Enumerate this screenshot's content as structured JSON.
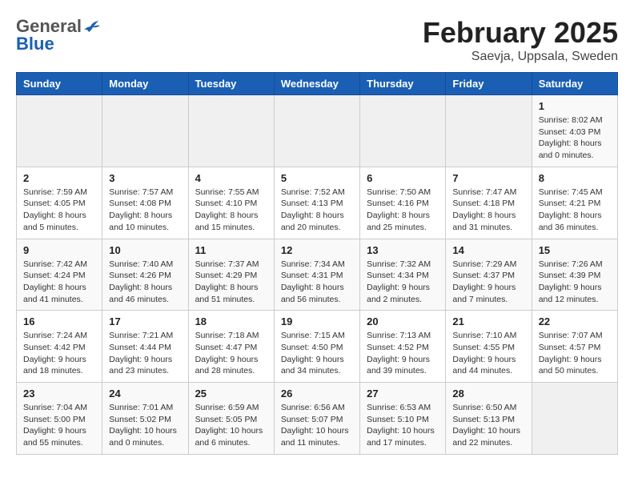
{
  "header": {
    "logo_general": "General",
    "logo_blue": "Blue",
    "month_title": "February 2025",
    "location": "Saevja, Uppsala, Sweden"
  },
  "weekdays": [
    "Sunday",
    "Monday",
    "Tuesday",
    "Wednesday",
    "Thursday",
    "Friday",
    "Saturday"
  ],
  "weeks": [
    [
      {
        "day": "",
        "info": ""
      },
      {
        "day": "",
        "info": ""
      },
      {
        "day": "",
        "info": ""
      },
      {
        "day": "",
        "info": ""
      },
      {
        "day": "",
        "info": ""
      },
      {
        "day": "",
        "info": ""
      },
      {
        "day": "1",
        "info": "Sunrise: 8:02 AM\nSunset: 4:03 PM\nDaylight: 8 hours and 0 minutes."
      }
    ],
    [
      {
        "day": "2",
        "info": "Sunrise: 7:59 AM\nSunset: 4:05 PM\nDaylight: 8 hours and 5 minutes."
      },
      {
        "day": "3",
        "info": "Sunrise: 7:57 AM\nSunset: 4:08 PM\nDaylight: 8 hours and 10 minutes."
      },
      {
        "day": "4",
        "info": "Sunrise: 7:55 AM\nSunset: 4:10 PM\nDaylight: 8 hours and 15 minutes."
      },
      {
        "day": "5",
        "info": "Sunrise: 7:52 AM\nSunset: 4:13 PM\nDaylight: 8 hours and 20 minutes."
      },
      {
        "day": "6",
        "info": "Sunrise: 7:50 AM\nSunset: 4:16 PM\nDaylight: 8 hours and 25 minutes."
      },
      {
        "day": "7",
        "info": "Sunrise: 7:47 AM\nSunset: 4:18 PM\nDaylight: 8 hours and 31 minutes."
      },
      {
        "day": "8",
        "info": "Sunrise: 7:45 AM\nSunset: 4:21 PM\nDaylight: 8 hours and 36 minutes."
      }
    ],
    [
      {
        "day": "9",
        "info": "Sunrise: 7:42 AM\nSunset: 4:24 PM\nDaylight: 8 hours and 41 minutes."
      },
      {
        "day": "10",
        "info": "Sunrise: 7:40 AM\nSunset: 4:26 PM\nDaylight: 8 hours and 46 minutes."
      },
      {
        "day": "11",
        "info": "Sunrise: 7:37 AM\nSunset: 4:29 PM\nDaylight: 8 hours and 51 minutes."
      },
      {
        "day": "12",
        "info": "Sunrise: 7:34 AM\nSunset: 4:31 PM\nDaylight: 8 hours and 56 minutes."
      },
      {
        "day": "13",
        "info": "Sunrise: 7:32 AM\nSunset: 4:34 PM\nDaylight: 9 hours and 2 minutes."
      },
      {
        "day": "14",
        "info": "Sunrise: 7:29 AM\nSunset: 4:37 PM\nDaylight: 9 hours and 7 minutes."
      },
      {
        "day": "15",
        "info": "Sunrise: 7:26 AM\nSunset: 4:39 PM\nDaylight: 9 hours and 12 minutes."
      }
    ],
    [
      {
        "day": "16",
        "info": "Sunrise: 7:24 AM\nSunset: 4:42 PM\nDaylight: 9 hours and 18 minutes."
      },
      {
        "day": "17",
        "info": "Sunrise: 7:21 AM\nSunset: 4:44 PM\nDaylight: 9 hours and 23 minutes."
      },
      {
        "day": "18",
        "info": "Sunrise: 7:18 AM\nSunset: 4:47 PM\nDaylight: 9 hours and 28 minutes."
      },
      {
        "day": "19",
        "info": "Sunrise: 7:15 AM\nSunset: 4:50 PM\nDaylight: 9 hours and 34 minutes."
      },
      {
        "day": "20",
        "info": "Sunrise: 7:13 AM\nSunset: 4:52 PM\nDaylight: 9 hours and 39 minutes."
      },
      {
        "day": "21",
        "info": "Sunrise: 7:10 AM\nSunset: 4:55 PM\nDaylight: 9 hours and 44 minutes."
      },
      {
        "day": "22",
        "info": "Sunrise: 7:07 AM\nSunset: 4:57 PM\nDaylight: 9 hours and 50 minutes."
      }
    ],
    [
      {
        "day": "23",
        "info": "Sunrise: 7:04 AM\nSunset: 5:00 PM\nDaylight: 9 hours and 55 minutes."
      },
      {
        "day": "24",
        "info": "Sunrise: 7:01 AM\nSunset: 5:02 PM\nDaylight: 10 hours and 0 minutes."
      },
      {
        "day": "25",
        "info": "Sunrise: 6:59 AM\nSunset: 5:05 PM\nDaylight: 10 hours and 6 minutes."
      },
      {
        "day": "26",
        "info": "Sunrise: 6:56 AM\nSunset: 5:07 PM\nDaylight: 10 hours and 11 minutes."
      },
      {
        "day": "27",
        "info": "Sunrise: 6:53 AM\nSunset: 5:10 PM\nDaylight: 10 hours and 17 minutes."
      },
      {
        "day": "28",
        "info": "Sunrise: 6:50 AM\nSunset: 5:13 PM\nDaylight: 10 hours and 22 minutes."
      },
      {
        "day": "",
        "info": ""
      }
    ]
  ]
}
